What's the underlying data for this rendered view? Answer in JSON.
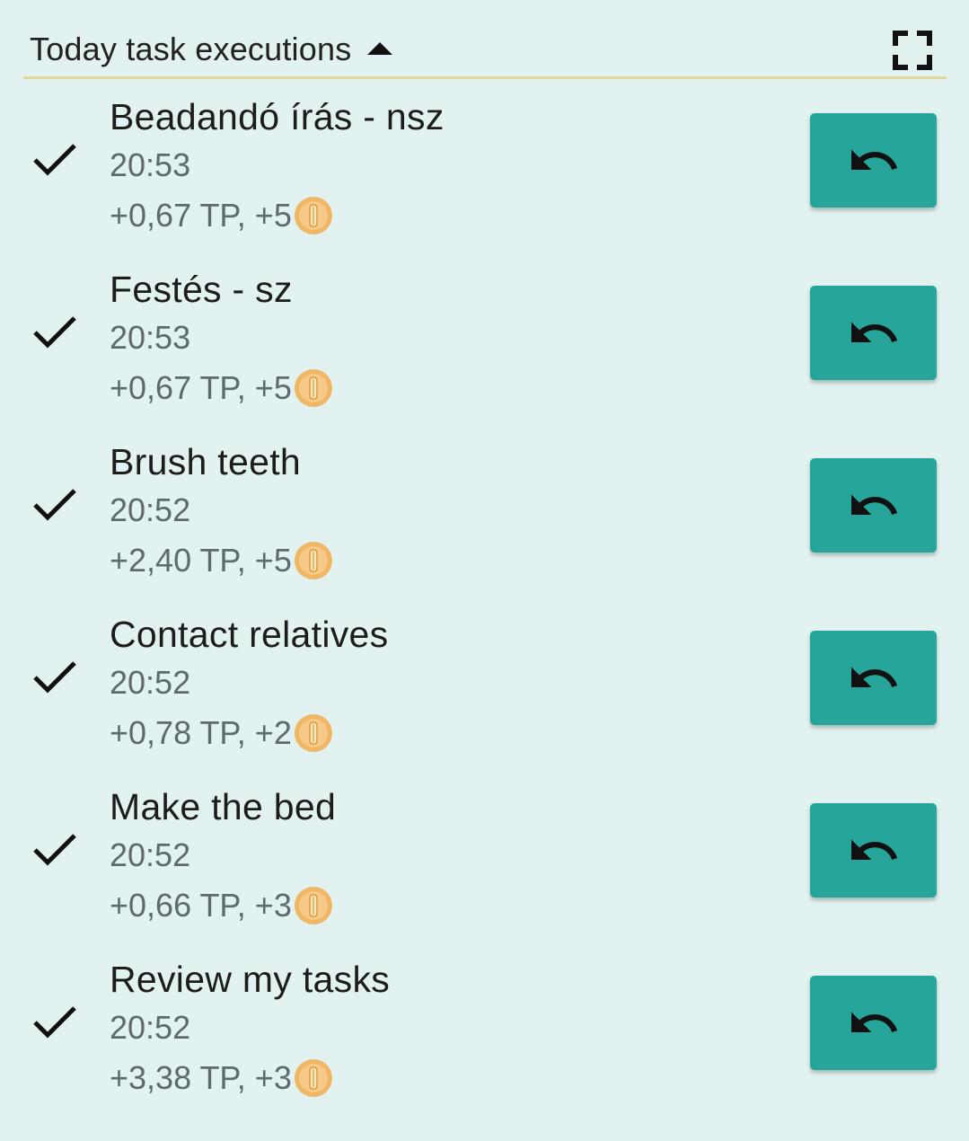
{
  "header": {
    "title": "Today task executions"
  },
  "colors": {
    "background": "#e1f2f1",
    "accent": "#26a69a",
    "divider": "#e6d59a",
    "coin": "#f0b663"
  },
  "tasks": [
    {
      "name": "Beadandó írás - nsz",
      "time": "20:53",
      "reward": "+0,67 TP, +5"
    },
    {
      "name": "Festés - sz",
      "time": "20:53",
      "reward": "+0,67 TP, +5"
    },
    {
      "name": "Brush teeth",
      "time": "20:52",
      "reward": "+2,40 TP, +5"
    },
    {
      "name": "Contact relatives",
      "time": "20:52",
      "reward": "+0,78 TP, +2"
    },
    {
      "name": "Make the bed",
      "time": "20:52",
      "reward": "+0,66 TP, +3"
    },
    {
      "name": "Review my tasks",
      "time": "20:52",
      "reward": "+3,38 TP, +3"
    }
  ],
  "icons": {
    "collapse": "caret-up-icon",
    "fullscreen": "fullscreen-icon",
    "done": "check-icon",
    "currency": "coin-icon",
    "undo": "undo-icon"
  }
}
